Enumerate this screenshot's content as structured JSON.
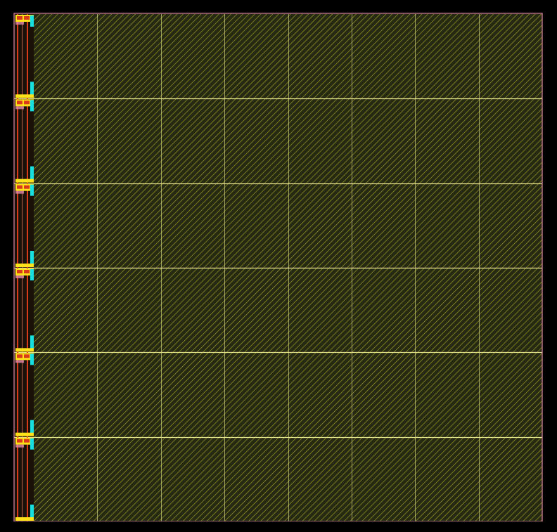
{
  "layout": {
    "cell_rows": 6,
    "cell_columns": 8,
    "edge_cell_count": 6,
    "colors": {
      "canvas_background": "#000000",
      "cell_fill": "#262a12",
      "hatch_stripe": "#c3c02e",
      "grid_line": "#e8e48f",
      "boundary": "#e28aa8",
      "poly_strip": "#d83a1a",
      "diffusion_strip": "#ff8a6e",
      "contact_pad": "#ffe21a",
      "via_bar": "#18e0e0",
      "outer_frame": "#000000"
    }
  }
}
